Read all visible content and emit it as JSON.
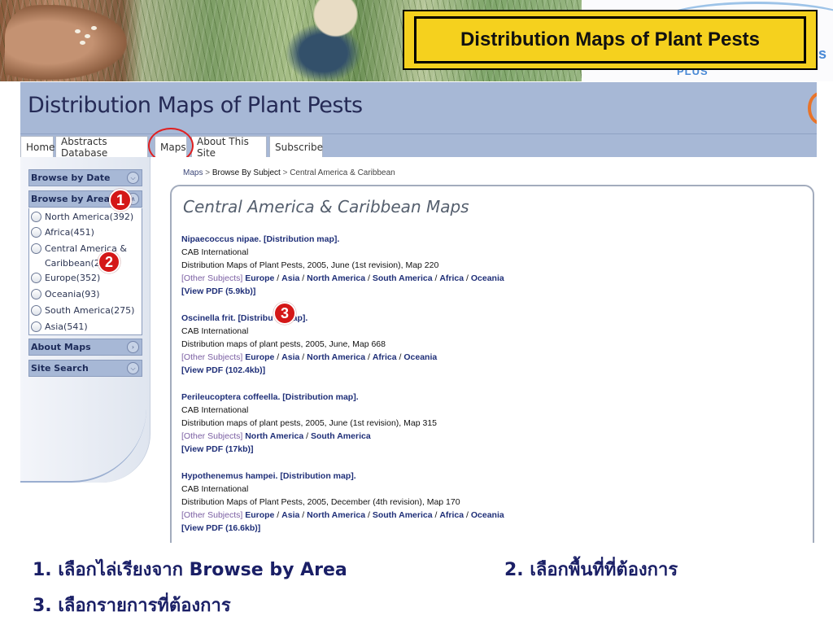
{
  "banner": {
    "title": "Distribution Maps of Plant Pests",
    "logo_text_s": "s",
    "logo_text_plus": "PLUS"
  },
  "site": {
    "title": "Distribution Maps of Plant Pests",
    "nav": [
      "Home",
      "Abstracts Database",
      "Maps",
      "About This Site",
      "Subscribe"
    ],
    "highlighted_nav": "Maps"
  },
  "sidebar": {
    "browse_by_date": "Browse by Date",
    "browse_by_area": "Browse by Area",
    "areas": [
      "North America(392)",
      "Africa(451)",
      "Central America &",
      "Caribbean(20",
      "Europe(352)",
      "Oceania(93)",
      "South America(275)",
      "Asia(541)"
    ],
    "about_maps": "About Maps",
    "site_search": "Site Search"
  },
  "breadcrumb": {
    "maps": "Maps",
    "sep1": " > ",
    "subject": "Browse By Subject",
    "sep2": " > ",
    "current": "Central America & Caribbean"
  },
  "panel": {
    "title": "Central America & Caribbean Maps",
    "entries": [
      {
        "title": "Nipaecoccus nipae. [Distribution map].",
        "publisher": "CAB International",
        "citation": "Distribution Maps of Plant Pests, 2005, June (1st revision), Map 220",
        "other_label": "[Other Subjects]",
        "regions": [
          "Europe",
          "Asia",
          "North America",
          "South America",
          "Africa",
          "Oceania"
        ],
        "pdf": "[View PDF (5.9kb)]"
      },
      {
        "title": "Oscinella frit. [Distribu",
        "title_tail": "ap].",
        "publisher": "CAB International",
        "citation": "Distribution maps of plant pests, 2005, June, Map 668",
        "other_label": "[Other Subjects]",
        "regions": [
          "Europe",
          "Asia",
          "North America",
          "Africa",
          "Oceania"
        ],
        "pdf": "[View PDF (102.4kb)]"
      },
      {
        "title": "Perileucoptera coffeella. [Distribution map].",
        "publisher": "CAB International",
        "citation": "Distribution maps of plant pests, 2005, June (1st revision), Map 315",
        "other_label": "[Other Subjects]",
        "regions": [
          "North America",
          "South America"
        ],
        "pdf": "[View PDF (17kb)]"
      },
      {
        "title": "Hypothenemus hampei. [Distribution map].",
        "publisher": "CAB International",
        "citation": "Distribution Maps of Plant Pests, 2005, December (4th revision), Map 170",
        "other_label": "[Other Subjects]",
        "regions": [
          "Europe",
          "Asia",
          "North America",
          "South America",
          "Africa",
          "Oceania"
        ],
        "pdf": "[View PDF (16.6kb)]"
      }
    ]
  },
  "markers": [
    "1",
    "2",
    "3"
  ],
  "instructions": {
    "step1": "1. เลือกไล่เรียงจาก Browse by Area",
    "step2": "2. เลือกพื้นที่ที่ต้องการ",
    "step3": "3. เลือกรายการที่ต้องการ"
  },
  "colors": {
    "banner_title_bg": "#f5d11e",
    "header_bg": "#a7b8d6",
    "marker": "#d41717",
    "highlight_ring": "#e02020",
    "instruction_text": "#1a1f66"
  }
}
